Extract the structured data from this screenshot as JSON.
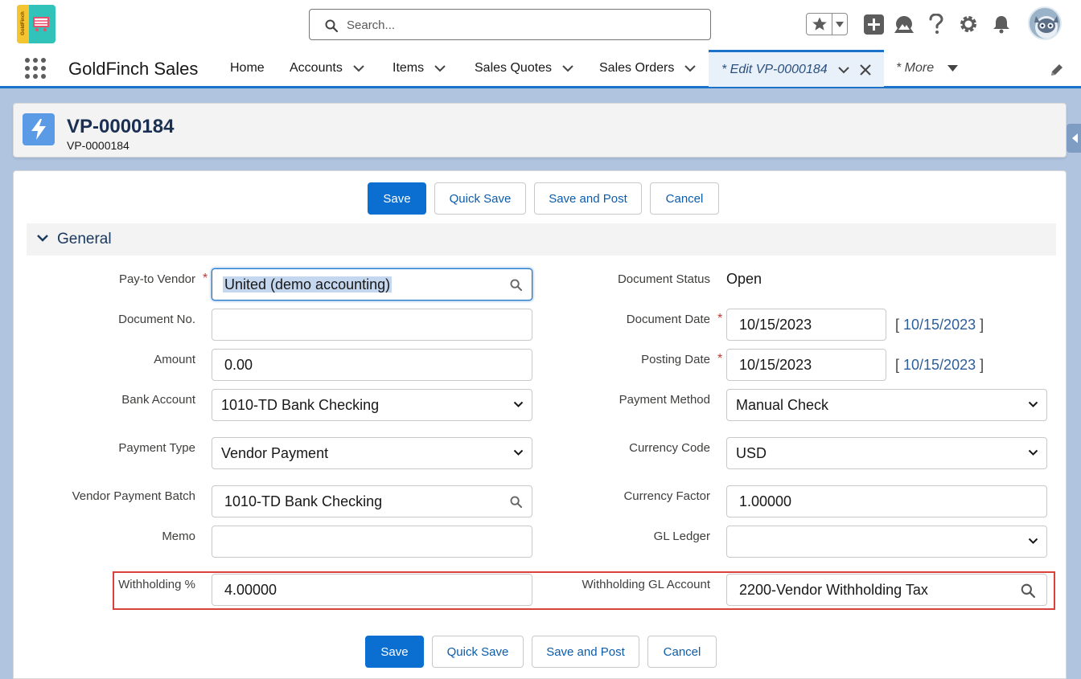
{
  "header": {
    "logo_text": "GoldFinch",
    "search_placeholder": "Search...",
    "icons": [
      "star-icon",
      "chevron-down-icon",
      "add-icon",
      "trailhead-icon",
      "help-icon",
      "gear-icon",
      "bell-icon",
      "avatar"
    ]
  },
  "nav": {
    "app_name": "GoldFinch Sales",
    "items": [
      {
        "label": "Home"
      },
      {
        "label": "Accounts"
      },
      {
        "label": "Items"
      },
      {
        "label": "Sales Quotes"
      },
      {
        "label": "Sales Orders"
      }
    ],
    "active_tab": "* Edit VP-0000184",
    "more_label": "* More"
  },
  "record": {
    "title": "VP-0000184",
    "subtitle": "VP-0000184"
  },
  "buttons": {
    "save": "Save",
    "quick_save": "Quick Save",
    "save_and_post": "Save and Post",
    "cancel": "Cancel"
  },
  "section": {
    "title": "General"
  },
  "fields": {
    "pay_to_vendor": {
      "label": "Pay-to Vendor",
      "value": "United (demo accounting)",
      "required": true
    },
    "document_no": {
      "label": "Document No.",
      "value": ""
    },
    "amount": {
      "label": "Amount",
      "value": "0.00"
    },
    "bank_account": {
      "label": "Bank Account",
      "value": "1010-TD Bank Checking"
    },
    "payment_type": {
      "label": "Payment Type",
      "value": "Vendor Payment"
    },
    "vendor_payment_batch": {
      "label": "Vendor Payment Batch",
      "value": "1010-TD Bank Checking"
    },
    "memo": {
      "label": "Memo",
      "value": ""
    },
    "withholding_pct": {
      "label": "Withholding %",
      "value": "4.00000"
    },
    "document_status": {
      "label": "Document Status",
      "value": "Open"
    },
    "document_date": {
      "label": "Document Date",
      "value": "10/15/2023",
      "link": "10/15/2023",
      "required": true
    },
    "posting_date": {
      "label": "Posting Date",
      "value": "10/15/2023",
      "link": "10/15/2023",
      "required": true
    },
    "payment_method": {
      "label": "Payment Method",
      "value": "Manual Check"
    },
    "currency_code": {
      "label": "Currency Code",
      "value": "USD"
    },
    "currency_factor": {
      "label": "Currency Factor",
      "value": "1.00000"
    },
    "gl_ledger": {
      "label": "GL Ledger",
      "value": ""
    },
    "withholding_gl_account": {
      "label": "Withholding GL Account",
      "value": "2200-Vendor Withholding Tax"
    }
  },
  "colors": {
    "brand_blue": "#0b6fd1",
    "required_red": "#c23934",
    "highlight_red": "#d9413d"
  }
}
